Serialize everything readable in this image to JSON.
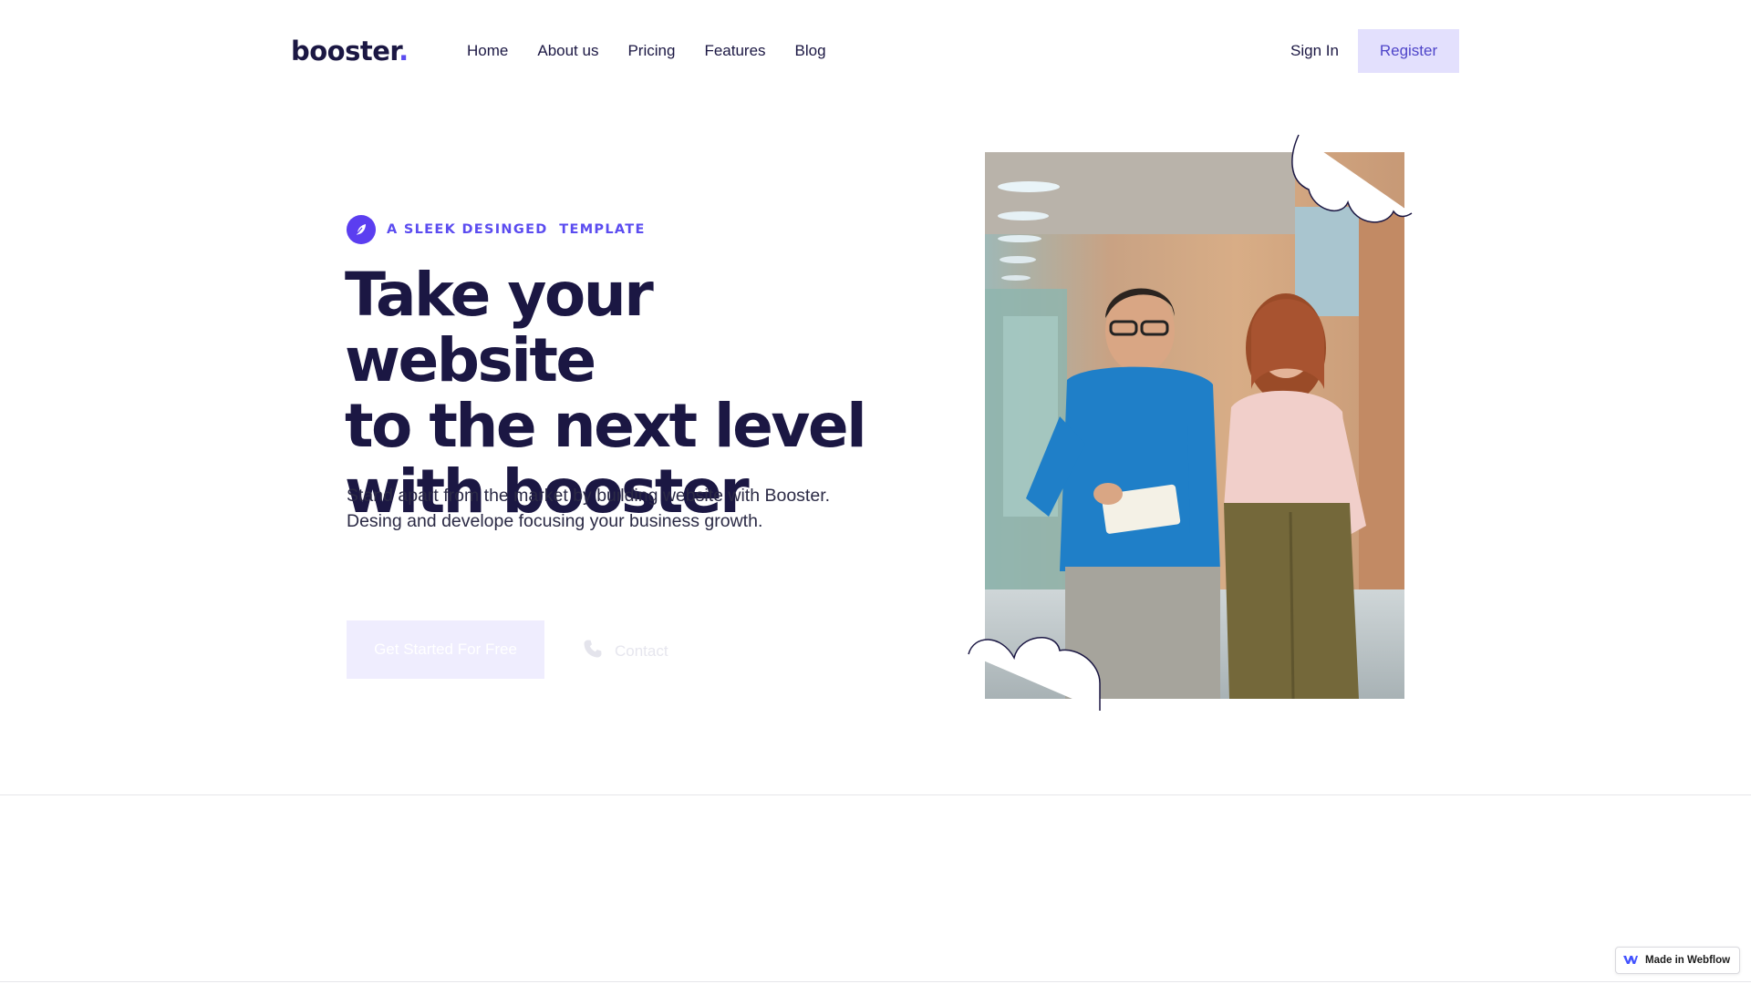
{
  "header": {
    "logo_text": "booster",
    "logo_dot": ".",
    "nav": [
      {
        "label": "Home"
      },
      {
        "label": "About us"
      },
      {
        "label": "Pricing"
      },
      {
        "label": "Features"
      },
      {
        "label": "Blog"
      }
    ],
    "signin_label": "Sign In",
    "register_label": "Register"
  },
  "hero": {
    "badge_icon": "feather-icon",
    "badge_text": "A SLEEK DESINGED  TEMPLATE",
    "title_line1": "Take your website",
    "title_line2": "to the next level",
    "title_line3": "with booster",
    "subtitle_line1": "Stand apart from the market by building website with Booster.",
    "subtitle_line2": "Desing and develope focusing your business growth.",
    "cta_primary": "Get Started For Free",
    "cta_contact": "Contact",
    "contact_icon": "phone-icon",
    "image": "photo of two coworkers in office"
  },
  "footer_badge": {
    "label": "Made in Webflow",
    "icon": "webflow-logo-icon"
  },
  "colors": {
    "brand": "#5b4cf0",
    "dark": "#1b1743",
    "register_bg": "#e3e0fd",
    "cta_bg": "#efedfe"
  }
}
